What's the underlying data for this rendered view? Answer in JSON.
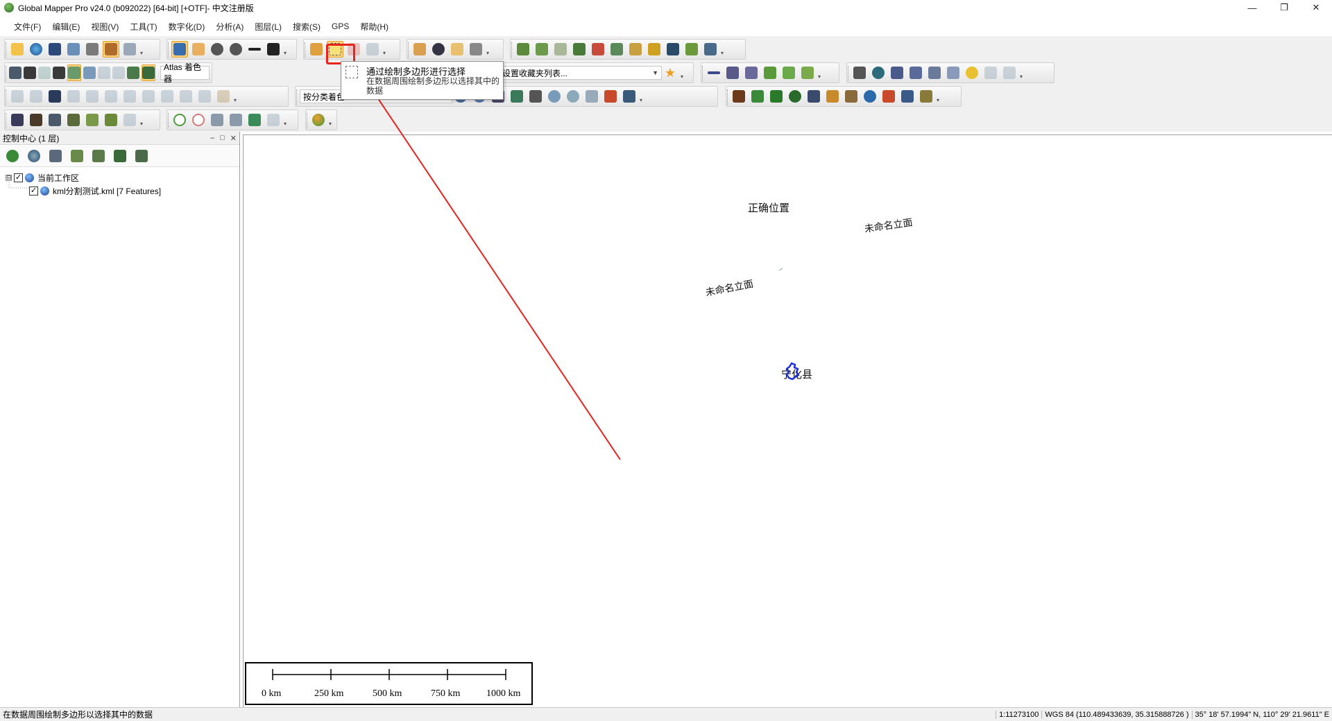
{
  "window": {
    "title": "Global Mapper Pro v24.0 (b092022) [64-bit] [+OTF]- 中文注册版",
    "minimize": "—",
    "restore": "❐",
    "close": "✕"
  },
  "menubar": {
    "items": [
      "文件(F)",
      "编辑(E)",
      "视图(V)",
      "工具(T)",
      "数字化(D)",
      "分析(A)",
      "图层(L)",
      "搜索(S)",
      "GPS",
      "帮助(H)"
    ]
  },
  "toolbar": {
    "shader_combo": "Atlas 着色器",
    "classify_combo": "按分类着色",
    "favorites_combo": "设置收藏夹列表..."
  },
  "tooltip": {
    "title": "通过绘制多边形进行选择",
    "description": "在数据周围绘制多边形以选择其中的数据"
  },
  "control_center": {
    "title": "控制中心 (1 层)",
    "min_btn": "–",
    "max_btn": "□",
    "close_btn": "✕",
    "tree": {
      "workspace_expander": "⊟",
      "workspace_label": "当前工作区",
      "layer_label": "kml分割测试.kml [7 Features]"
    }
  },
  "map": {
    "labels": {
      "correct_position": "正确位置",
      "unnamed_facade_1": "未命名立面",
      "unnamed_facade_2": "未命名立面",
      "county": "宁化县"
    },
    "scale_bar": {
      "ticks": [
        "0 km",
        "250 km",
        "500 km",
        "750 km",
        "1000 km"
      ]
    }
  },
  "statusbar": {
    "message": "在数据周围绘制多边形以选择其中的数据",
    "scale": "1:11273100",
    "projection": "WGS 84 (110.489433639, 35.315888726 )",
    "coords": "35° 18' 57.1994\" N, 110° 29' 21.9611\" E"
  },
  "colors": {
    "highlight_red": "#e8231e",
    "active_button": "#ffd37a",
    "county_polygon": "#1e2fd8"
  }
}
